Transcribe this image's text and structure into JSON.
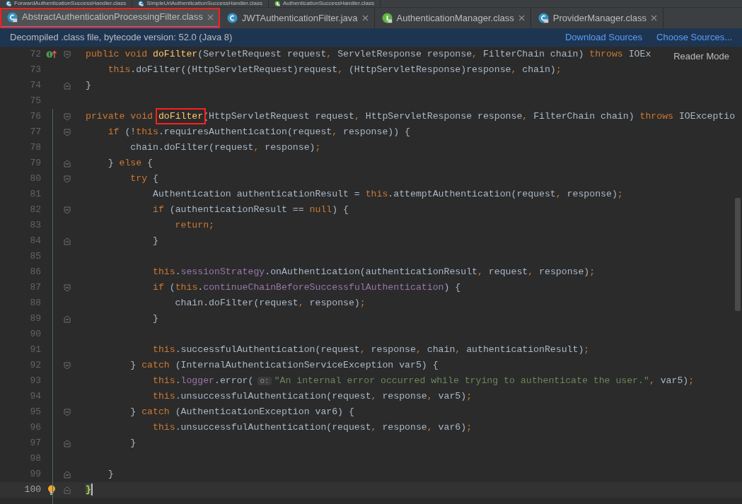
{
  "upper_tabs": [
    {
      "label": "ForwardAuthenticationSuccessHandler.class",
      "kind": "class",
      "locked": true
    },
    {
      "label": "SimpleUrlAuthenticationSuccessHandler.class",
      "kind": "class",
      "locked": true
    },
    {
      "label": "AuthenticationSuccessHandler.class",
      "kind": "interface",
      "locked": true
    }
  ],
  "tabs": [
    {
      "label": "AbstractAuthenticationProcessingFilter.class",
      "kind": "class",
      "locked": true,
      "selected": true,
      "outlined": true
    },
    {
      "label": "JWTAuthenticationFilter.java",
      "kind": "class",
      "locked": false,
      "selected": false,
      "outlined": false
    },
    {
      "label": "AuthenticationManager.class",
      "kind": "interface",
      "locked": true,
      "selected": false,
      "outlined": false
    },
    {
      "label": "ProviderManager.class",
      "kind": "class",
      "locked": true,
      "selected": false,
      "outlined": false
    }
  ],
  "info_bar": {
    "message": "Decompiled .class file, bytecode version: 52.0 (Java 8)",
    "links": [
      "Download Sources",
      "Choose Sources..."
    ]
  },
  "reader_mode": "Reader Mode",
  "lines": [
    {
      "number": "72",
      "fold_start": true,
      "fold_end": false,
      "implements_marker": true,
      "current": false,
      "tokens": [
        {
          "kind": "keyword",
          "text": "public void "
        },
        {
          "kind": "decl",
          "text": "doFilter"
        },
        {
          "kind": "plain",
          "text": "(ServletRequest request"
        },
        {
          "kind": "keyword",
          "text": ", "
        },
        {
          "kind": "plain",
          "text": "ServletResponse response"
        },
        {
          "kind": "keyword",
          "text": ", "
        },
        {
          "kind": "plain",
          "text": "FilterChain chain) "
        },
        {
          "kind": "keyword",
          "text": "throws "
        },
        {
          "kind": "plain",
          "text": "IOEx"
        }
      ]
    },
    {
      "number": "73",
      "fold_start": false,
      "fold_end": false,
      "current": false,
      "tokens": [
        {
          "kind": "keyword",
          "text": "    this"
        },
        {
          "kind": "plain",
          "text": ".doFilter((HttpServletRequest)request"
        },
        {
          "kind": "keyword",
          "text": ", "
        },
        {
          "kind": "plain",
          "text": "(HttpServletResponse)response"
        },
        {
          "kind": "keyword",
          "text": ", "
        },
        {
          "kind": "plain",
          "text": "chain)"
        },
        {
          "kind": "keyword",
          "text": ";"
        }
      ]
    },
    {
      "number": "74",
      "fold_start": false,
      "fold_end": true,
      "current": false,
      "tokens": [
        {
          "kind": "plain",
          "text": "}"
        }
      ]
    },
    {
      "number": "75",
      "fold_start": false,
      "fold_end": false,
      "current": false
    },
    {
      "number": "76",
      "fold_start": true,
      "fold_end": false,
      "current": false,
      "tokens": [
        {
          "kind": "keyword",
          "text": "private void "
        },
        {
          "kind": "decl",
          "text": "doFilter",
          "boxed": true
        },
        {
          "kind": "plain",
          "text": "(HttpServletRequest request"
        },
        {
          "kind": "keyword",
          "text": ", "
        },
        {
          "kind": "plain",
          "text": "HttpServletResponse response"
        },
        {
          "kind": "keyword",
          "text": ", "
        },
        {
          "kind": "plain",
          "text": "FilterChain chain) "
        },
        {
          "kind": "keyword",
          "text": "throws "
        },
        {
          "kind": "plain",
          "text": "IOExceptio"
        }
      ]
    },
    {
      "number": "77",
      "fold_start": true,
      "fold_end": false,
      "current": false,
      "tokens": [
        {
          "kind": "keyword",
          "text": "    if "
        },
        {
          "kind": "plain",
          "text": "(!"
        },
        {
          "kind": "keyword",
          "text": "this"
        },
        {
          "kind": "plain",
          "text": ".requiresAuthentication(request"
        },
        {
          "kind": "keyword",
          "text": ", "
        },
        {
          "kind": "plain",
          "text": "response)) {"
        }
      ]
    },
    {
      "number": "78",
      "fold_start": false,
      "fold_end": false,
      "current": false,
      "tokens": [
        {
          "kind": "plain",
          "text": "        chain.doFilter(request"
        },
        {
          "kind": "keyword",
          "text": ", "
        },
        {
          "kind": "plain",
          "text": "response)"
        },
        {
          "kind": "keyword",
          "text": ";"
        }
      ]
    },
    {
      "number": "79",
      "fold_start": false,
      "fold_end": true,
      "current": false,
      "tokens": [
        {
          "kind": "plain",
          "text": "    } "
        },
        {
          "kind": "keyword",
          "text": "else "
        },
        {
          "kind": "plain",
          "text": "{"
        }
      ]
    },
    {
      "number": "80",
      "fold_start": true,
      "fold_end": false,
      "current": false,
      "tokens": [
        {
          "kind": "keyword",
          "text": "        try "
        },
        {
          "kind": "plain",
          "text": "{"
        }
      ]
    },
    {
      "number": "81",
      "fold_start": false,
      "fold_end": false,
      "current": false,
      "tokens": [
        {
          "kind": "plain",
          "text": "            Authentication authenticationResult = "
        },
        {
          "kind": "keyword",
          "text": "this"
        },
        {
          "kind": "plain",
          "text": ".attemptAuthentication(request"
        },
        {
          "kind": "keyword",
          "text": ", "
        },
        {
          "kind": "plain",
          "text": "response)"
        },
        {
          "kind": "keyword",
          "text": ";"
        }
      ]
    },
    {
      "number": "82",
      "fold_start": true,
      "fold_end": false,
      "current": false,
      "tokens": [
        {
          "kind": "keyword",
          "text": "            if "
        },
        {
          "kind": "plain",
          "text": "(authenticationResult == "
        },
        {
          "kind": "keyword",
          "text": "null"
        },
        {
          "kind": "plain",
          "text": ") {"
        }
      ]
    },
    {
      "number": "83",
      "fold_start": false,
      "fold_end": false,
      "current": false,
      "tokens": [
        {
          "kind": "keyword",
          "text": "                return;"
        }
      ]
    },
    {
      "number": "84",
      "fold_start": false,
      "fold_end": true,
      "current": false,
      "tokens": [
        {
          "kind": "plain",
          "text": "            }"
        }
      ]
    },
    {
      "number": "85",
      "fold_start": false,
      "fold_end": false,
      "current": false
    },
    {
      "number": "86",
      "fold_start": false,
      "fold_end": false,
      "current": false,
      "tokens": [
        {
          "kind": "keyword",
          "text": "            this"
        },
        {
          "kind": "plain",
          "text": "."
        },
        {
          "kind": "field",
          "text": "sessionStrategy"
        },
        {
          "kind": "plain",
          "text": ".onAuthentication(authenticationResult"
        },
        {
          "kind": "keyword",
          "text": ", "
        },
        {
          "kind": "plain",
          "text": "request"
        },
        {
          "kind": "keyword",
          "text": ", "
        },
        {
          "kind": "plain",
          "text": "response)"
        },
        {
          "kind": "keyword",
          "text": ";"
        }
      ]
    },
    {
      "number": "87",
      "fold_start": true,
      "fold_end": false,
      "current": false,
      "tokens": [
        {
          "kind": "keyword",
          "text": "            if "
        },
        {
          "kind": "plain",
          "text": "("
        },
        {
          "kind": "keyword",
          "text": "this"
        },
        {
          "kind": "plain",
          "text": "."
        },
        {
          "kind": "field",
          "text": "continueChainBeforeSuccessfulAuthentication"
        },
        {
          "kind": "plain",
          "text": ") {"
        }
      ]
    },
    {
      "number": "88",
      "fold_start": false,
      "fold_end": false,
      "current": false,
      "tokens": [
        {
          "kind": "plain",
          "text": "                chain.doFilter(request"
        },
        {
          "kind": "keyword",
          "text": ", "
        },
        {
          "kind": "plain",
          "text": "response)"
        },
        {
          "kind": "keyword",
          "text": ";"
        }
      ]
    },
    {
      "number": "89",
      "fold_start": false,
      "fold_end": true,
      "current": false,
      "tokens": [
        {
          "kind": "plain",
          "text": "            }"
        }
      ]
    },
    {
      "number": "90",
      "fold_start": false,
      "fold_end": false,
      "current": false
    },
    {
      "number": "91",
      "fold_start": false,
      "fold_end": false,
      "current": false,
      "tokens": [
        {
          "kind": "keyword",
          "text": "            this"
        },
        {
          "kind": "plain",
          "text": ".successfulAuthentication(request"
        },
        {
          "kind": "keyword",
          "text": ", "
        },
        {
          "kind": "plain",
          "text": "response"
        },
        {
          "kind": "keyword",
          "text": ", "
        },
        {
          "kind": "plain",
          "text": "chain"
        },
        {
          "kind": "keyword",
          "text": ", "
        },
        {
          "kind": "plain",
          "text": "authenticationResult)"
        },
        {
          "kind": "keyword",
          "text": ";"
        }
      ]
    },
    {
      "number": "92",
      "fold_start": true,
      "fold_end": false,
      "current": false,
      "tokens": [
        {
          "kind": "plain",
          "text": "        } "
        },
        {
          "kind": "keyword",
          "text": "catch "
        },
        {
          "kind": "plain",
          "text": "(InternalAuthenticationServiceException var5) {"
        }
      ]
    },
    {
      "number": "93",
      "fold_start": false,
      "fold_end": false,
      "current": false,
      "tokens": [
        {
          "kind": "keyword",
          "text": "            this"
        },
        {
          "kind": "plain",
          "text": "."
        },
        {
          "kind": "field",
          "text": "logger"
        },
        {
          "kind": "plain",
          "text": ".error("
        },
        {
          "kind": "hint",
          "text": "o:"
        },
        {
          "kind": "string",
          "text": "\"An internal error occurred while trying to authenticate the user.\""
        },
        {
          "kind": "keyword",
          "text": ", "
        },
        {
          "kind": "plain",
          "text": "var5)"
        },
        {
          "kind": "keyword",
          "text": ";"
        }
      ]
    },
    {
      "number": "94",
      "fold_start": false,
      "fold_end": false,
      "current": false,
      "tokens": [
        {
          "kind": "keyword",
          "text": "            this"
        },
        {
          "kind": "plain",
          "text": ".unsuccessfulAuthentication(request"
        },
        {
          "kind": "keyword",
          "text": ", "
        },
        {
          "kind": "plain",
          "text": "response"
        },
        {
          "kind": "keyword",
          "text": ", "
        },
        {
          "kind": "plain",
          "text": "var5)"
        },
        {
          "kind": "keyword",
          "text": ";"
        }
      ]
    },
    {
      "number": "95",
      "fold_start": true,
      "fold_end": false,
      "current": false,
      "tokens": [
        {
          "kind": "plain",
          "text": "        } "
        },
        {
          "kind": "keyword",
          "text": "catch "
        },
        {
          "kind": "plain",
          "text": "(AuthenticationException var6) {"
        }
      ]
    },
    {
      "number": "96",
      "fold_start": false,
      "fold_end": false,
      "current": false,
      "tokens": [
        {
          "kind": "keyword",
          "text": "            this"
        },
        {
          "kind": "plain",
          "text": ".unsuccessfulAuthentication(request"
        },
        {
          "kind": "keyword",
          "text": ", "
        },
        {
          "kind": "plain",
          "text": "response"
        },
        {
          "kind": "keyword",
          "text": ", "
        },
        {
          "kind": "plain",
          "text": "var6)"
        },
        {
          "kind": "keyword",
          "text": ";"
        }
      ]
    },
    {
      "number": "97",
      "fold_start": false,
      "fold_end": true,
      "current": false,
      "tokens": [
        {
          "kind": "plain",
          "text": "        }"
        }
      ]
    },
    {
      "number": "98",
      "fold_start": false,
      "fold_end": false,
      "current": false
    },
    {
      "number": "99",
      "fold_start": false,
      "fold_end": true,
      "current": false,
      "tokens": [
        {
          "kind": "plain",
          "text": "    }"
        }
      ]
    },
    {
      "number": "100",
      "fold_start": false,
      "fold_end": true,
      "intention_bulb": true,
      "current": true,
      "tokens": [
        {
          "kind": "brace",
          "text": "}"
        }
      ]
    }
  ]
}
